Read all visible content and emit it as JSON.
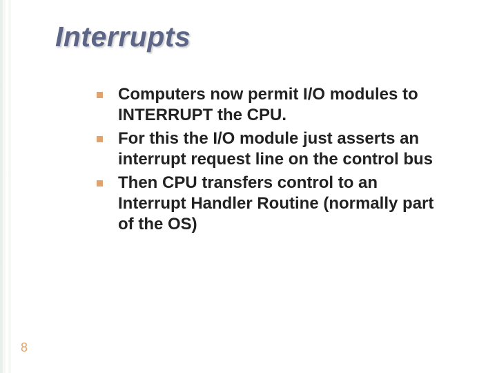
{
  "slide": {
    "title": "Interrupts",
    "bullets": [
      "Computers now permit I/O modules to INTERRUPT the CPU.",
      "For this the I/O module just asserts an interrupt request line on the control bus",
      "Then CPU transfers control to an Interrupt Handler Routine (normally part of the OS)"
    ],
    "page_number": "8"
  },
  "colors": {
    "title": "#5d6686",
    "bullet_square": "#e1a36b",
    "page_number": "#e1a36b"
  }
}
